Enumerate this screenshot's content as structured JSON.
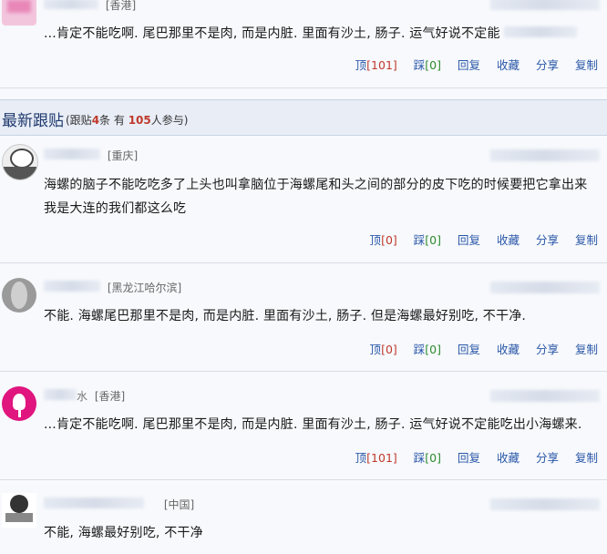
{
  "posts_top": {
    "user_location": "[香港]",
    "content": "...肯定不能吃啊. 尾巴那里不是肉, 而是内脏. 里面有沙土, 肠子. 运气好说不定能",
    "actions": {
      "ding": "顶",
      "ding_count": "[101]",
      "cai": "踩",
      "cai_count": "[0]",
      "reply": "回复",
      "fav": "收藏",
      "share": "分享",
      "copy": "复制"
    }
  },
  "section": {
    "title": "最新跟贴",
    "stats_prefix": "(跟贴",
    "stats_count": "4",
    "stats_mid": "条 有",
    "stats_people": "105",
    "stats_suffix": "人参与)"
  },
  "posts": [
    {
      "location": "[重庆]",
      "content": "海螺的脑子不能吃吃多了上头也叫拿脑位于海螺尾和头之间的部分的皮下吃的时候要把它拿出来我是大连的我们都这么吃",
      "actions": {
        "ding": "顶",
        "ding_count": "[0]",
        "cai": "踩",
        "cai_count": "[0]",
        "reply": "回复",
        "fav": "收藏",
        "share": "分享",
        "copy": "复制"
      }
    },
    {
      "location": "[黑龙江哈尔滨]",
      "content": "不能. 海螺尾巴那里不是肉, 而是内脏. 里面有沙土, 肠子. 但是海螺最好别吃, 不干净.",
      "actions": {
        "ding": "顶",
        "ding_count": "[0]",
        "cai": "踩",
        "cai_count": "[0]",
        "reply": "回复",
        "fav": "收藏",
        "share": "分享",
        "copy": "复制"
      }
    },
    {
      "name_tail": "水",
      "location": "[香港]",
      "content": "...肯定不能吃啊. 尾巴那里不是肉, 而是内脏. 里面有沙土, 肠子. 运气好说不定能吃出小海螺来.",
      "actions": {
        "ding": "顶",
        "ding_count": "[101]",
        "cai": "踩",
        "cai_count": "[0]",
        "reply": "回复",
        "fav": "收藏",
        "share": "分享",
        "copy": "复制"
      }
    },
    {
      "location": "[中国]",
      "content": "不能, 海螺最好别吃, 不干净"
    }
  ]
}
